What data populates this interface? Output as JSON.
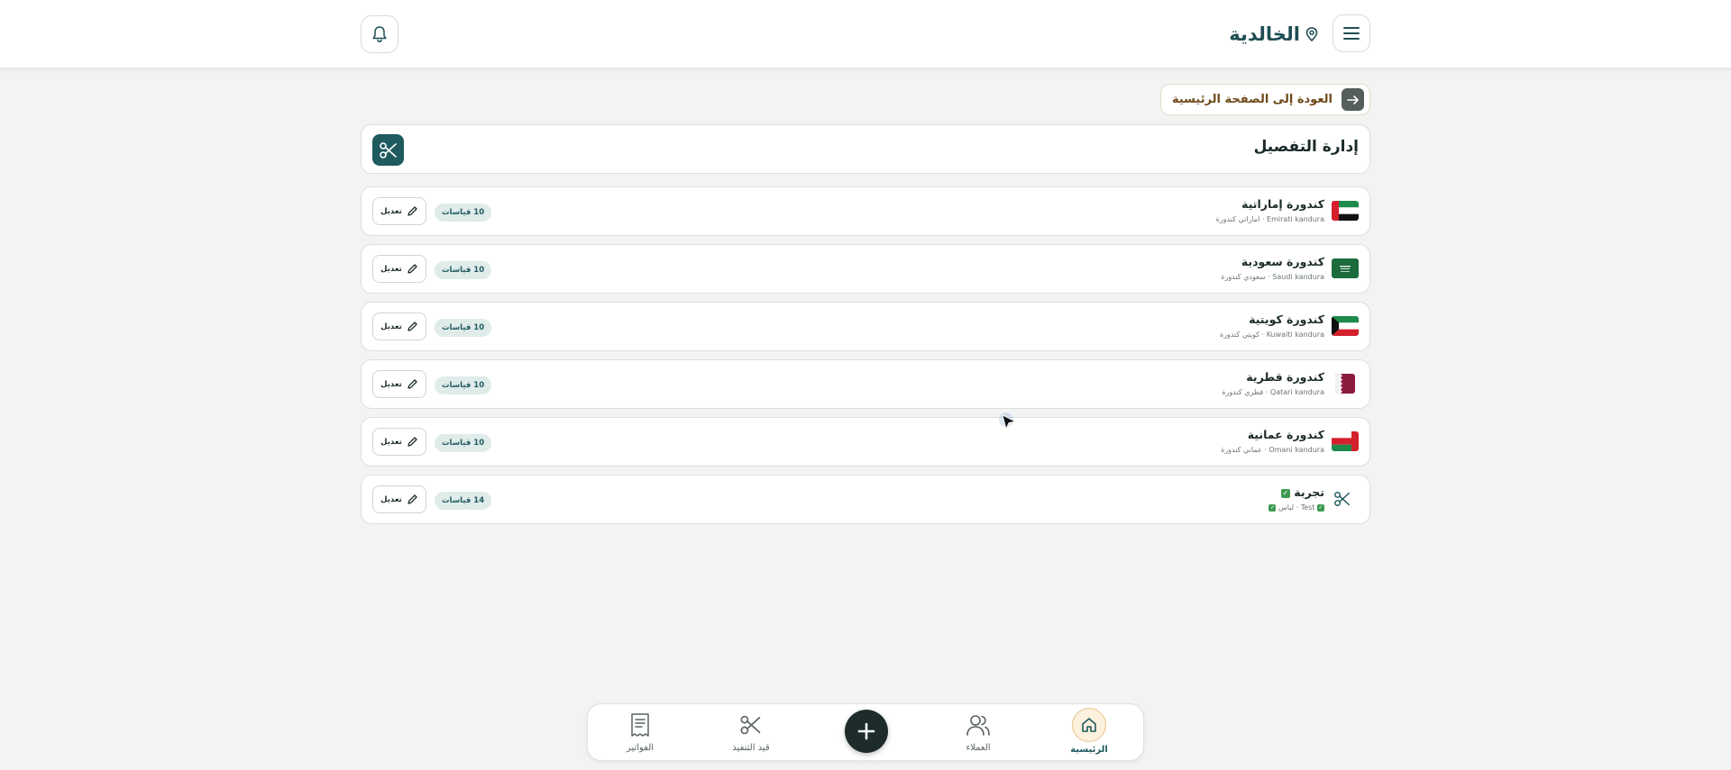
{
  "header": {
    "location": "الخالدية",
    "menu_icon": "menu-icon",
    "location_icon": "map-pin-icon",
    "bell_icon": "bell-icon"
  },
  "back": {
    "label": "العودة إلى الصفحة الرئيسية",
    "icon": "arrow-right-icon"
  },
  "page": {
    "title": "إدارة التفصيل",
    "title_icon": "scissors-icon"
  },
  "rows": [
    {
      "name": "كندورة إماراتية",
      "sub": "Emirati kandura · اماراتي كندورة",
      "badge": "10 قياسات",
      "edit": "تعديل",
      "flag": "uae"
    },
    {
      "name": "كندورة سعودية",
      "sub": "Saudi kandura · سعودي كندورة",
      "badge": "10 قياسات",
      "edit": "تعديل",
      "flag": "saudi"
    },
    {
      "name": "كندورة كويتية",
      "sub": "Kuwaiti kandura · كويتي كندورة",
      "badge": "10 قياسات",
      "edit": "تعديل",
      "flag": "kuwait"
    },
    {
      "name": "كندورة قطرية",
      "sub": "Qatari kandura · قطري كندورة",
      "badge": "10 قياسات",
      "edit": "تعديل",
      "flag": "qatar"
    },
    {
      "name": "كندورة عمانية",
      "sub": "Omani kandura · عماني كندورة",
      "badge": "10 قياسات",
      "edit": "تعديل",
      "flag": "oman"
    },
    {
      "name": "تجربة",
      "sub": "Test · لباس",
      "badge": "14 قياسات",
      "edit": "تعديل",
      "flag": "scissors"
    }
  ],
  "nav": {
    "home": "الرئيسية",
    "customers": "العملاء",
    "in_progress": "قيد التنفيذ",
    "invoices": "الفواتير",
    "add_icon": "plus-icon"
  },
  "colors": {
    "primary": "#1f5a5f",
    "dark": "#1e2b2b",
    "accent_brown": "#6f4a1a",
    "badge_bg": "#dfecea",
    "background": "#f3f3f3"
  }
}
